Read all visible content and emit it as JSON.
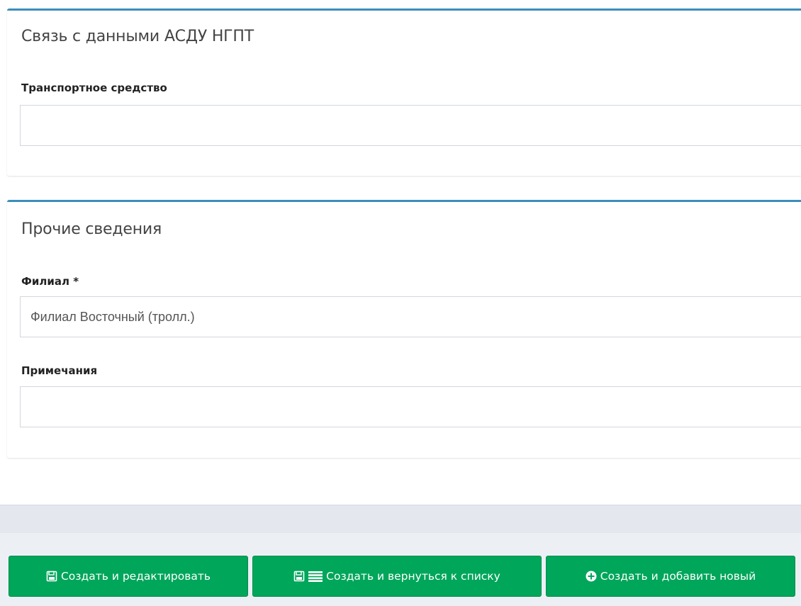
{
  "panels": {
    "link": {
      "title": "Связь с данными АСДУ НГПТ",
      "vehicle_label": "Транспортное средство",
      "vehicle_value": ""
    },
    "other": {
      "title": "Прочие сведения",
      "branch_label": "Филиал *",
      "branch_value": "Филиал Восточный (тролл.)",
      "notes_label": "Примечания",
      "notes_value": ""
    }
  },
  "actions": {
    "create_edit": "Создать и редактировать",
    "create_list": "Создать и вернуться к списку",
    "create_new": "Создать и добавить новый"
  },
  "icons": {
    "create_edit": "save-icon",
    "create_list": [
      "save-icon",
      "list-icon"
    ],
    "create_new": "plus-circle-icon"
  },
  "colors": {
    "panel_border": "#3c8dbc",
    "button_bg": "#00a65a",
    "button_border": "#008d4c"
  }
}
